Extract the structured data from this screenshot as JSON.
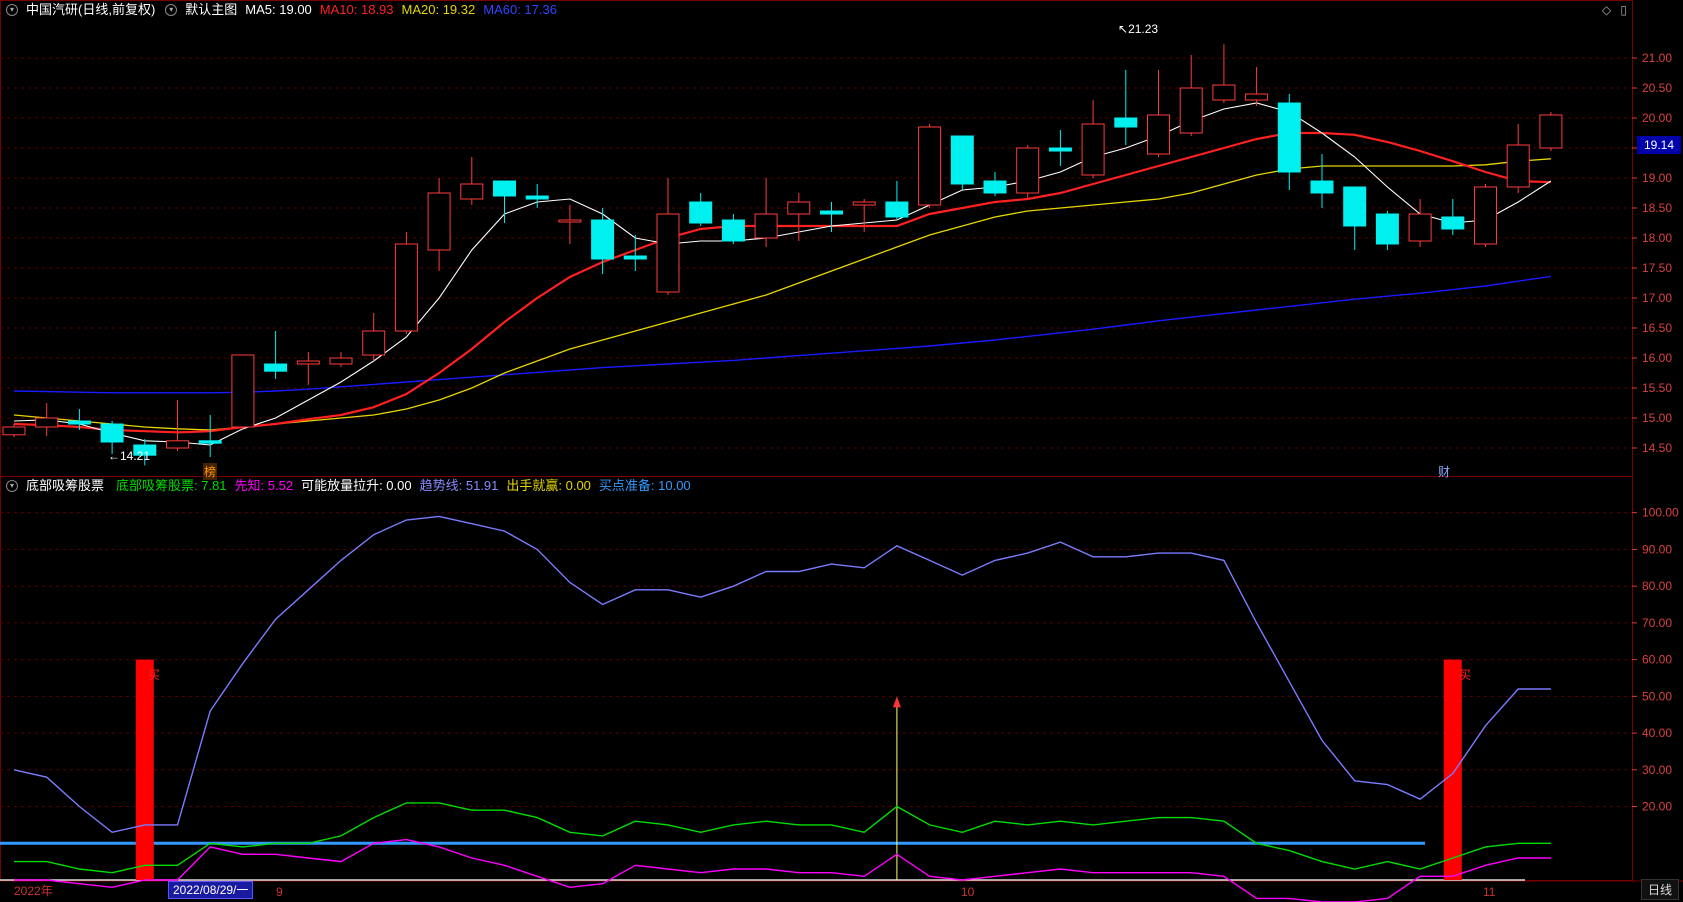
{
  "colors": {
    "up": "#ff3b3b",
    "down": "#00f0f0",
    "ma5": "#ffffff",
    "ma10": "#ff2020",
    "ma20": "#e6d600",
    "ma60": "#1a1aff",
    "green": "#00dd00",
    "magenta": "#ff00ff",
    "trend": "#7b7bff",
    "buy": "#ff0000",
    "hline_blue": "#3399ff",
    "hline_white": "#dddddd",
    "grid": "#5a0000",
    "axis_text": "#d94040"
  },
  "header_main": {
    "title": "中国汽研(日线,前复权)",
    "subtitle": "默认主图",
    "ma5": "MA5: 19.00",
    "ma10": "MA10: 18.93",
    "ma20": "MA20: 19.32",
    "ma60": "MA60: 17.36"
  },
  "header_sub": {
    "title": "底部吸筹股票",
    "i1": "底部吸筹股票: 7.81",
    "i2": "先知: 5.52",
    "i3": "可能放量拉升: 0.00",
    "i4": "趋势线: 51.91",
    "i5": "出手就赢: 0.00",
    "i6": "买点准备: 10.00"
  },
  "annotations": {
    "high_label": "21.23",
    "low_label": "14.21",
    "tag_bang": "榜",
    "tag_cai": "财",
    "buy_text": "买",
    "price_box": "19.14"
  },
  "x_axis": {
    "year": "2022年",
    "date_box": "2022/08/29/一",
    "m9": "9",
    "m10": "10",
    "m11": "11",
    "period": "日线"
  },
  "icons": {
    "collapse": "chevron-down-icon",
    "diamond": "diamond-icon",
    "window": "window-icon"
  },
  "chart_data": [
    {
      "type": "candlestick",
      "title": "中国汽研(日线,前复权)",
      "y_axis_ticks": [
        14.5,
        15.0,
        15.5,
        16.0,
        16.5,
        17.0,
        17.5,
        18.0,
        18.5,
        19.0,
        19.5,
        20.0,
        20.5,
        21.0
      ],
      "ylim": [
        14.0,
        21.6
      ],
      "candles": [
        {
          "o": 14.72,
          "h": 14.9,
          "l": 14.68,
          "c": 14.85
        },
        {
          "o": 14.85,
          "h": 15.25,
          "l": 14.7,
          "c": 15.0
        },
        {
          "o": 14.95,
          "h": 15.15,
          "l": 14.8,
          "c": 14.9
        },
        {
          "o": 14.9,
          "h": 14.95,
          "l": 14.4,
          "c": 14.6
        },
        {
          "o": 14.55,
          "h": 14.65,
          "l": 14.21,
          "c": 14.38
        },
        {
          "o": 14.5,
          "h": 15.3,
          "l": 14.45,
          "c": 14.62
        },
        {
          "o": 14.62,
          "h": 15.05,
          "l": 14.35,
          "c": 14.58
        },
        {
          "o": 14.85,
          "h": 16.05,
          "l": 14.8,
          "c": 16.05
        },
        {
          "o": 15.9,
          "h": 16.45,
          "l": 15.65,
          "c": 15.78
        },
        {
          "o": 15.9,
          "h": 16.1,
          "l": 15.55,
          "c": 15.95
        },
        {
          "o": 15.9,
          "h": 16.1,
          "l": 15.85,
          "c": 16.0
        },
        {
          "o": 16.05,
          "h": 16.75,
          "l": 15.95,
          "c": 16.45
        },
        {
          "o": 16.45,
          "h": 18.1,
          "l": 16.4,
          "c": 17.9
        },
        {
          "o": 17.8,
          "h": 19.0,
          "l": 17.45,
          "c": 18.75
        },
        {
          "o": 18.65,
          "h": 19.35,
          "l": 18.55,
          "c": 18.9
        },
        {
          "o": 18.95,
          "h": 18.95,
          "l": 18.25,
          "c": 18.7
        },
        {
          "o": 18.7,
          "h": 18.9,
          "l": 18.5,
          "c": 18.65
        },
        {
          "o": 18.3,
          "h": 18.55,
          "l": 17.9,
          "c": 18.3
        },
        {
          "o": 18.3,
          "h": 18.5,
          "l": 17.4,
          "c": 17.65
        },
        {
          "o": 17.7,
          "h": 18.05,
          "l": 17.45,
          "c": 17.65
        },
        {
          "o": 17.1,
          "h": 19.0,
          "l": 17.05,
          "c": 18.4
        },
        {
          "o": 18.6,
          "h": 18.75,
          "l": 18.2,
          "c": 18.25
        },
        {
          "o": 18.3,
          "h": 18.4,
          "l": 17.9,
          "c": 17.95
        },
        {
          "o": 18.0,
          "h": 19.0,
          "l": 17.85,
          "c": 18.4
        },
        {
          "o": 18.4,
          "h": 18.75,
          "l": 17.95,
          "c": 18.6
        },
        {
          "o": 18.45,
          "h": 18.6,
          "l": 18.1,
          "c": 18.4
        },
        {
          "o": 18.55,
          "h": 18.65,
          "l": 18.1,
          "c": 18.6
        },
        {
          "o": 18.6,
          "h": 18.95,
          "l": 18.3,
          "c": 18.35
        },
        {
          "o": 18.55,
          "h": 19.9,
          "l": 18.5,
          "c": 19.85
        },
        {
          "o": 19.7,
          "h": 19.7,
          "l": 18.8,
          "c": 18.9
        },
        {
          "o": 18.95,
          "h": 19.1,
          "l": 18.7,
          "c": 18.75
        },
        {
          "o": 18.75,
          "h": 19.55,
          "l": 18.65,
          "c": 19.5
        },
        {
          "o": 19.5,
          "h": 19.8,
          "l": 19.2,
          "c": 19.45
        },
        {
          "o": 19.05,
          "h": 20.3,
          "l": 19.0,
          "c": 19.9
        },
        {
          "o": 20.0,
          "h": 20.8,
          "l": 19.55,
          "c": 19.85
        },
        {
          "o": 19.4,
          "h": 20.8,
          "l": 19.35,
          "c": 20.05
        },
        {
          "o": 19.75,
          "h": 21.05,
          "l": 19.7,
          "c": 20.5
        },
        {
          "o": 20.3,
          "h": 21.23,
          "l": 20.25,
          "c": 20.55
        },
        {
          "o": 20.3,
          "h": 20.85,
          "l": 20.2,
          "c": 20.4
        },
        {
          "o": 20.25,
          "h": 20.4,
          "l": 18.8,
          "c": 19.1
        },
        {
          "o": 18.95,
          "h": 19.4,
          "l": 18.5,
          "c": 18.75
        },
        {
          "o": 18.85,
          "h": 18.85,
          "l": 17.8,
          "c": 18.2
        },
        {
          "o": 18.4,
          "h": 18.45,
          "l": 17.8,
          "c": 17.9
        },
        {
          "o": 17.95,
          "h": 18.65,
          "l": 17.85,
          "c": 18.4
        },
        {
          "o": 18.35,
          "h": 18.65,
          "l": 18.05,
          "c": 18.15
        },
        {
          "o": 17.9,
          "h": 18.9,
          "l": 17.85,
          "c": 18.85
        },
        {
          "o": 18.85,
          "h": 19.9,
          "l": 18.75,
          "c": 19.55
        },
        {
          "o": 19.5,
          "h": 20.1,
          "l": 19.45,
          "c": 20.05
        }
      ],
      "ma5": [
        14.95,
        14.97,
        14.9,
        14.75,
        14.62,
        14.6,
        14.55,
        14.82,
        15.0,
        15.3,
        15.6,
        15.95,
        16.35,
        17.0,
        17.8,
        18.4,
        18.6,
        18.65,
        18.4,
        18.0,
        17.9,
        17.95,
        17.95,
        18.0,
        18.1,
        18.2,
        18.25,
        18.3,
        18.55,
        18.8,
        18.85,
        18.95,
        19.1,
        19.35,
        19.5,
        19.7,
        19.95,
        20.15,
        20.25,
        20.1,
        19.75,
        19.35,
        18.85,
        18.4,
        18.25,
        18.3,
        18.6,
        18.95
      ],
      "ma10": [
        14.9,
        14.88,
        14.85,
        14.8,
        14.78,
        14.76,
        14.78,
        14.85,
        14.9,
        14.98,
        15.05,
        15.18,
        15.4,
        15.75,
        16.15,
        16.6,
        17.0,
        17.35,
        17.6,
        17.8,
        18.0,
        18.15,
        18.2,
        18.2,
        18.2,
        18.2,
        18.2,
        18.2,
        18.4,
        18.5,
        18.6,
        18.65,
        18.75,
        18.9,
        19.05,
        19.2,
        19.35,
        19.5,
        19.65,
        19.75,
        19.75,
        19.72,
        19.6,
        19.45,
        19.28,
        19.1,
        18.95,
        18.93
      ],
      "ma20": [
        15.05,
        15.0,
        14.95,
        14.9,
        14.85,
        14.82,
        14.8,
        14.85,
        14.9,
        14.95,
        15.0,
        15.05,
        15.15,
        15.3,
        15.5,
        15.75,
        15.95,
        16.15,
        16.3,
        16.45,
        16.6,
        16.75,
        16.9,
        17.05,
        17.25,
        17.45,
        17.65,
        17.85,
        18.05,
        18.2,
        18.35,
        18.45,
        18.5,
        18.55,
        18.6,
        18.65,
        18.75,
        18.9,
        19.05,
        19.15,
        19.2,
        19.2,
        19.2,
        19.2,
        19.2,
        19.22,
        19.28,
        19.32
      ],
      "ma60": [
        15.45,
        15.44,
        15.43,
        15.42,
        15.42,
        15.42,
        15.42,
        15.43,
        15.45,
        15.48,
        15.52,
        15.56,
        15.6,
        15.64,
        15.68,
        15.72,
        15.76,
        15.8,
        15.84,
        15.87,
        15.9,
        15.93,
        15.96,
        16.0,
        16.04,
        16.08,
        16.12,
        16.16,
        16.2,
        16.25,
        16.3,
        16.36,
        16.42,
        16.48,
        16.55,
        16.62,
        16.68,
        16.74,
        16.8,
        16.86,
        16.92,
        16.98,
        17.03,
        17.08,
        17.14,
        17.2,
        17.28,
        17.36
      ]
    },
    {
      "type": "line",
      "title": "底部吸筹股票",
      "y_axis_ticks": [
        20,
        30,
        40,
        50,
        60,
        70,
        80,
        90,
        100
      ],
      "ylim": [
        0,
        104
      ],
      "series": [
        {
          "name": "趋势线",
          "values": [
            30,
            28,
            20,
            13,
            15,
            15,
            46,
            59,
            71,
            79,
            87,
            94,
            98,
            99,
            97,
            95,
            90,
            81,
            75,
            79,
            79,
            77,
            80,
            84,
            84,
            86,
            85,
            91,
            87,
            83,
            87,
            89,
            92,
            88,
            88,
            89,
            89,
            87,
            70,
            54,
            38,
            27,
            26,
            22,
            29,
            42,
            52,
            52
          ]
        },
        {
          "name": "底部吸筹股票",
          "values": [
            5,
            5,
            3,
            2,
            4,
            4,
            10,
            9,
            10,
            10,
            12,
            17,
            21,
            21,
            19,
            19,
            17,
            13,
            12,
            16,
            15,
            13,
            15,
            16,
            15,
            15,
            13,
            20,
            15,
            13,
            16,
            15,
            16,
            15,
            16,
            17,
            17,
            16,
            10,
            8,
            5,
            3,
            5,
            3,
            6,
            9,
            10,
            10
          ]
        },
        {
          "name": "先知",
          "values": [
            0,
            0,
            0,
            0,
            0,
            0,
            0,
            0,
            0,
            0,
            0,
            0,
            0,
            0,
            0,
            0,
            0,
            0,
            0,
            0,
            0,
            0,
            0,
            0,
            0,
            0,
            0,
            0,
            0,
            0,
            0,
            0,
            0,
            0,
            0,
            0,
            0,
            0,
            0,
            0,
            0,
            0,
            0,
            0,
            0,
            0,
            0,
            0
          ]
        },
        {
          "name": "magenta_line",
          "values": [
            0,
            0,
            -1,
            -2,
            0,
            0,
            9,
            7,
            7,
            6,
            5,
            10,
            11,
            9,
            6,
            4,
            1,
            -2,
            -1,
            4,
            3,
            2,
            3,
            3,
            2,
            2,
            1,
            7,
            1,
            0,
            1,
            2,
            3,
            2,
            2,
            2,
            2,
            1,
            -5,
            -5,
            -6,
            -6,
            -5,
            1,
            1,
            4,
            6,
            6
          ]
        }
      ],
      "buy_markers_index": [
        4,
        44
      ],
      "arrow_index": 27,
      "hline_blue": 10,
      "hline_white": 0
    }
  ]
}
